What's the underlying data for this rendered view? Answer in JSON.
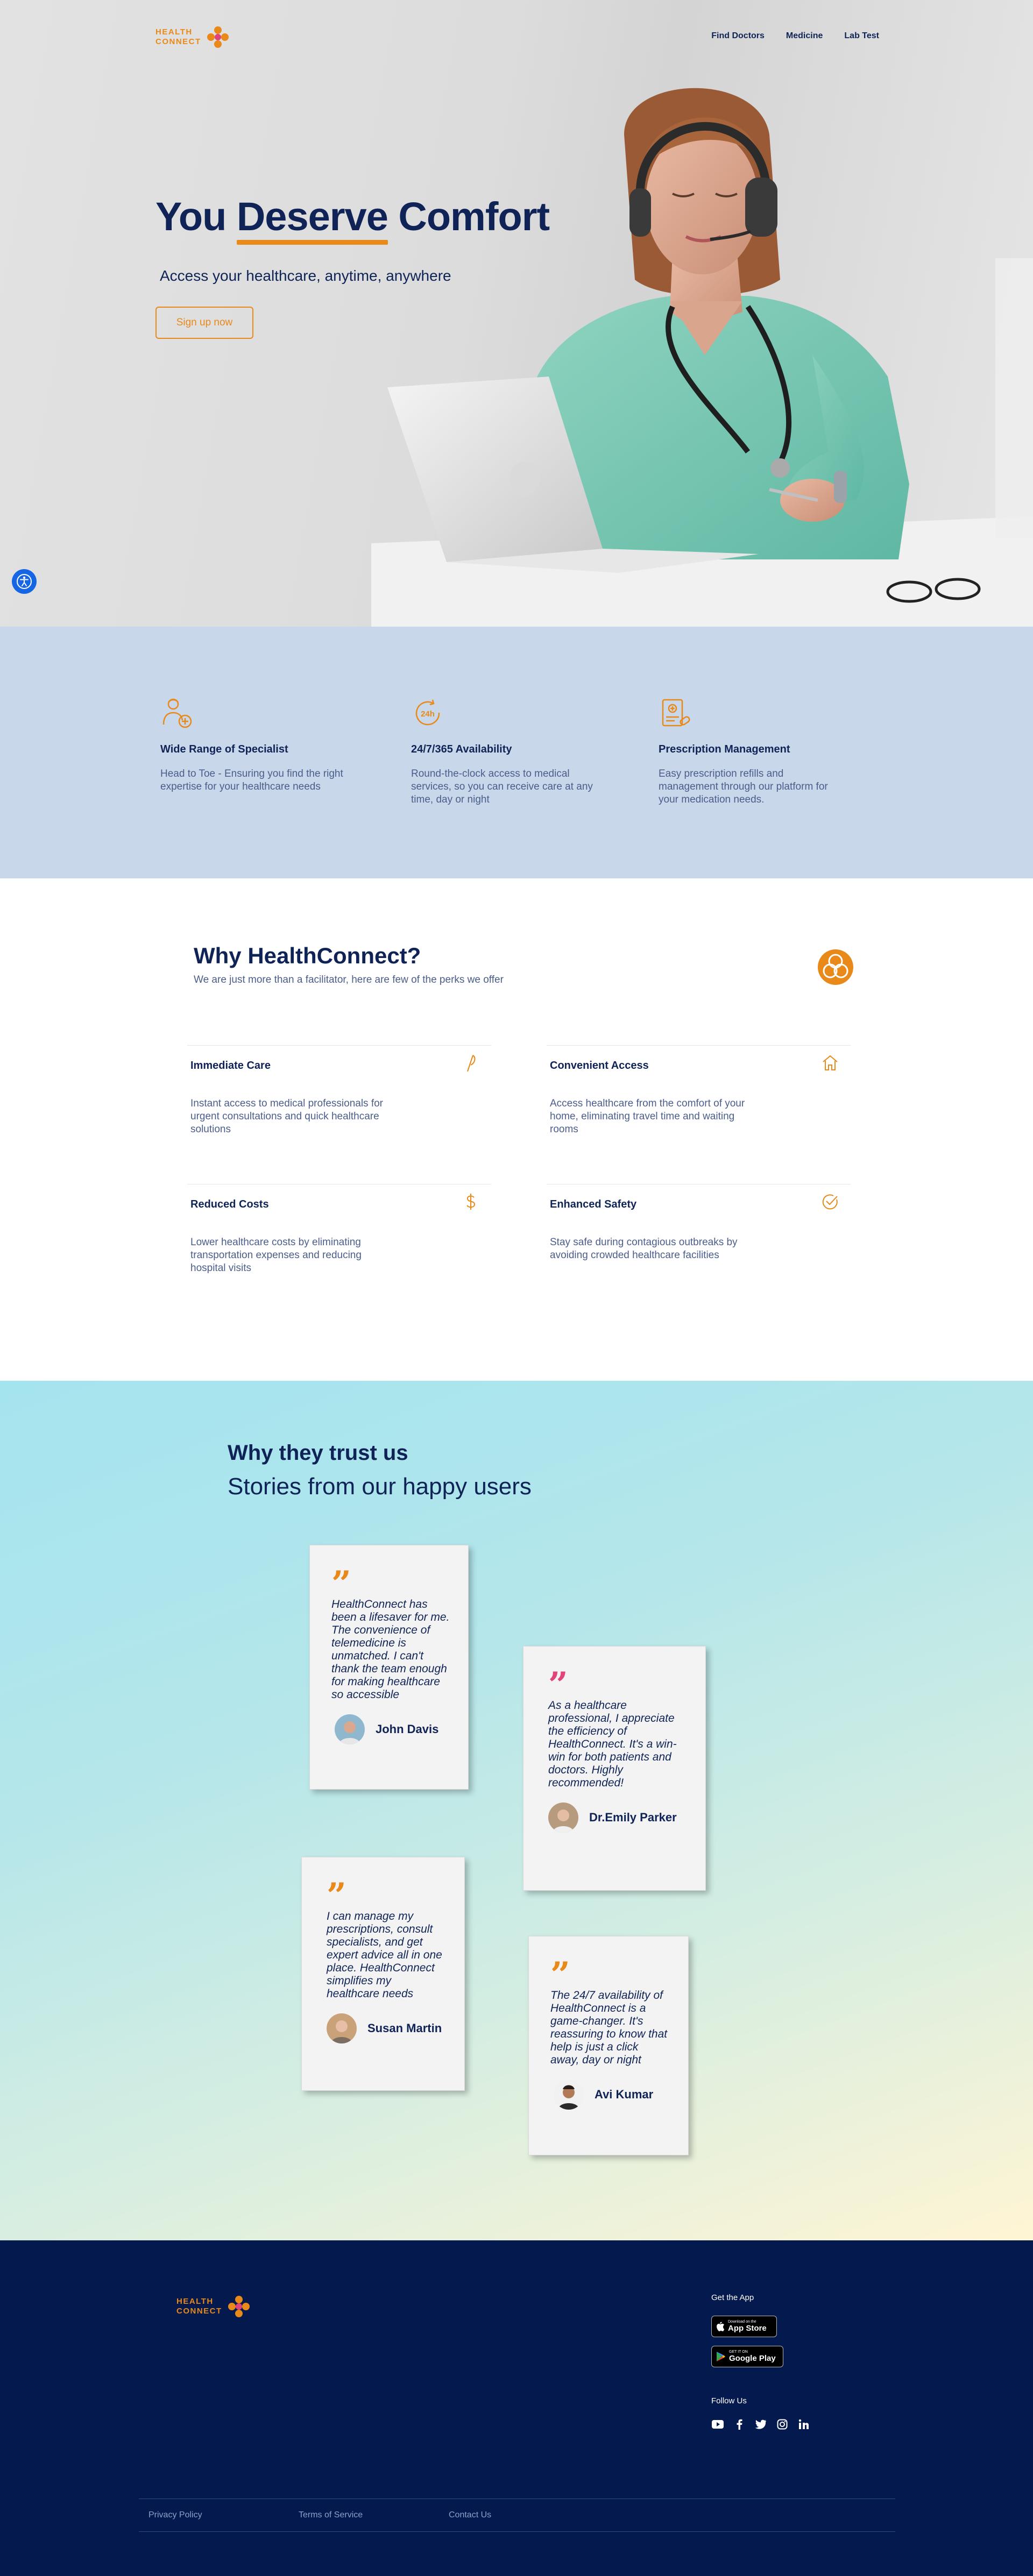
{
  "brand": {
    "line1": "HEALTH",
    "line2": "CONNECT",
    "accent": "#e8891a",
    "navy": "#0f2356"
  },
  "nav": {
    "items": [
      "Find Doctors",
      "Medicine",
      "Lab Test"
    ]
  },
  "hero": {
    "title_before": "You ",
    "title_underlined": "Deserve",
    "title_after": " Comfort",
    "subtitle": "Access your healthcare, anytime, anywhere",
    "cta": "Sign up now"
  },
  "features": [
    {
      "icon": "specialist-icon",
      "title": "Wide Range of Specialist",
      "text": "Head to Toe - Ensuring you find the right expertise for your healthcare needs"
    },
    {
      "icon": "24h-icon",
      "title": "24/7/365 Availability",
      "text": "Round-the-clock access to medical services, so you can receive care at any time, day or night"
    },
    {
      "icon": "prescription-icon",
      "title": "Prescription Management",
      "text": "Easy prescription refills and management through our platform for your medication needs."
    }
  ],
  "why": {
    "title": "Why HealthConnect?",
    "subtitle": "We are just more than a facilitator, here are few of the perks we offer",
    "perks": [
      {
        "icon": "feather-icon",
        "title": "Immediate Care",
        "text": "Instant access  to medical professionals for urgent consultations and quick healthcare solutions"
      },
      {
        "icon": "home-icon",
        "title": "Convenient Access",
        "text": "Access healthcare from the comfort of your home, eliminating travel time and waiting rooms"
      },
      {
        "icon": "dollar-icon",
        "title": "Reduced Costs",
        "text": "Lower healthcare costs by eliminating transportation expenses and reducing hospital visits"
      },
      {
        "icon": "shield-check-icon",
        "title": "Enhanced Safety",
        "text": "Stay safe during contagious outbreaks by avoiding crowded healthcare facilities"
      }
    ]
  },
  "trust": {
    "title": "Why they trust us",
    "subtitle": "Stories from our happy users",
    "testimonials": [
      {
        "quote": "HealthConnect has been a lifesaver for me. The convenience of telemedicine is unmatched. I can't thank the team enough for making healthcare so accessible",
        "name": "John Davis",
        "quote_color": "#e8891a"
      },
      {
        "quote": "As a healthcare professional, I appreciate the efficiency of HealthConnect. It's a win-win for both patients and doctors. Highly recommended!",
        "name": "Dr.Emily Parker",
        "quote_color": "#e0447a"
      },
      {
        "quote": "I can manage my prescriptions, consult specialists, and get expert advice all in one place. HealthConnect simplifies my healthcare needs",
        "name": "Susan Martin",
        "quote_color": "#e8891a"
      },
      {
        "quote": "The 24/7 availability of HealthConnect is a game-changer. It's reassuring to know that help is just a click away, day or night",
        "name": "Avi Kumar",
        "quote_color": "#e8891a"
      }
    ]
  },
  "footer": {
    "get_app": "Get the App",
    "app_store": {
      "small": "Download on the",
      "large": "App Store"
    },
    "google_play": {
      "small": "GET IT ON",
      "large": "Google Play"
    },
    "follow": "Follow Us",
    "socials": [
      "youtube-icon",
      "facebook-icon",
      "twitter-icon",
      "instagram-icon",
      "linkedin-icon"
    ],
    "links": [
      "Privacy Policy",
      "Terms of Service",
      "Contact Us"
    ],
    "background": "#041a4f"
  }
}
